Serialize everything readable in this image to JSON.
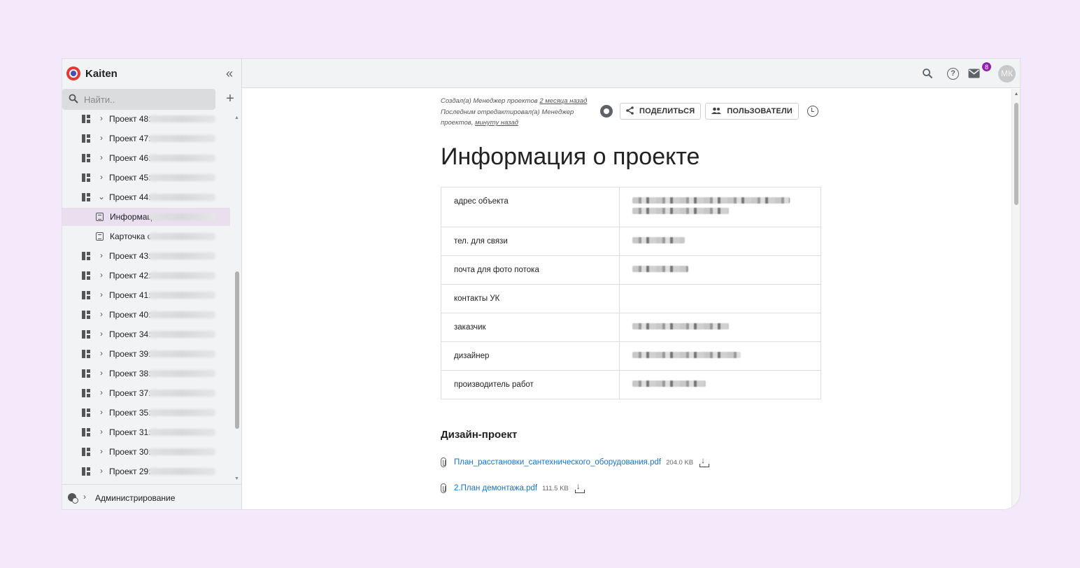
{
  "app": {
    "name": "Kaiten"
  },
  "sidebar": {
    "collapse_glyph": "«",
    "search_placeholder": "Найти..",
    "add_glyph": "+",
    "items": [
      {
        "label": "Проект 48:",
        "type": "board",
        "expanded": false
      },
      {
        "label": "Проект 47:",
        "type": "board",
        "expanded": false
      },
      {
        "label": "Проект 46:",
        "type": "board",
        "expanded": false
      },
      {
        "label": "Проект 45:",
        "type": "board",
        "expanded": false
      },
      {
        "label": "Проект 44:",
        "type": "board",
        "expanded": true
      },
      {
        "label": "Информаци",
        "type": "doc",
        "active": true
      },
      {
        "label": "Карточка о",
        "type": "doc"
      },
      {
        "label": "Проект 43:",
        "type": "board",
        "expanded": false
      },
      {
        "label": "Проект 42:",
        "type": "board",
        "expanded": false
      },
      {
        "label": "Проект 41:",
        "type": "board",
        "expanded": false
      },
      {
        "label": "Проект 40:",
        "type": "board",
        "expanded": false
      },
      {
        "label": "Проект 34:",
        "type": "board",
        "expanded": false
      },
      {
        "label": "Проект 39:",
        "type": "board",
        "expanded": false
      },
      {
        "label": "Проект 38:",
        "type": "board",
        "expanded": false
      },
      {
        "label": "Проект 37:",
        "type": "board",
        "expanded": false
      },
      {
        "label": "Проект 35:",
        "type": "board",
        "expanded": false
      },
      {
        "label": "Проект 31:",
        "type": "board",
        "expanded": false
      },
      {
        "label": "Проект 30:",
        "type": "board",
        "expanded": false
      },
      {
        "label": "Проект 29:",
        "type": "board",
        "expanded": false
      }
    ],
    "admin_label": "Администрирование"
  },
  "topbar": {
    "mail_badge": "8",
    "avatar_initials": "МК",
    "help_glyph": "?",
    "search_glyph": "⌕"
  },
  "doc": {
    "meta_created_prefix": "Создал(а) Менеджер проектов",
    "meta_created_link": "2 месяца назад",
    "meta_edited_prefix": "Последним отредактировал(а) Менеджер проектов,",
    "meta_edited_link": "минуту назад",
    "share_label": "Поделиться",
    "users_label": "Пользователи",
    "title": "Информация о проекте",
    "table_rows": [
      {
        "key": "адрес объекта",
        "value_redacted": true
      },
      {
        "key": "тел. для связи",
        "value_redacted": true
      },
      {
        "key": "почта для фото потока",
        "value_redacted": true
      },
      {
        "key": "контакты УК",
        "value_redacted": false
      },
      {
        "key": "заказчик",
        "value_redacted": true
      },
      {
        "key": "дизайнер",
        "value_redacted": true
      },
      {
        "key": "производитель работ",
        "value_redacted": true
      }
    ],
    "section_title": "Дизайн-проект",
    "files": [
      {
        "name": "План_расстановки_сантехнического_оборудования.pdf",
        "size": "204.0 KB"
      },
      {
        "name": "2.План демонтажа.pdf",
        "size": "111.5 KB"
      }
    ]
  },
  "colors": {
    "background": "#f3e9fb",
    "link": "#1a73c8",
    "badge": "#8e24aa",
    "active_item": "#e9dfee"
  }
}
